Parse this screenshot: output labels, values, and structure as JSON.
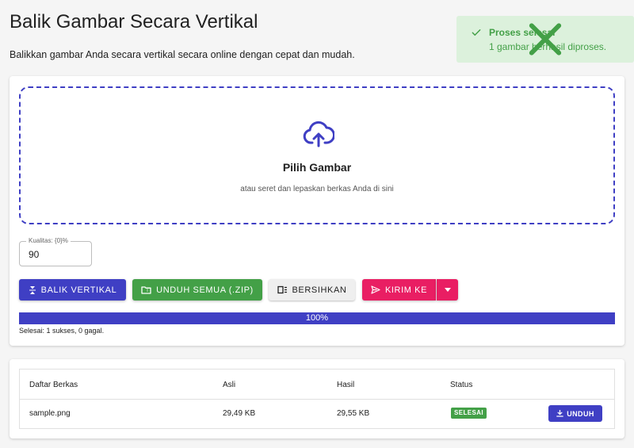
{
  "header": {
    "title": "Balik Gambar Secara Vertikal",
    "subtitle": "Balikkan gambar Anda secara vertikal secara online dengan cepat dan mudah."
  },
  "toast": {
    "title": "Proses selesai",
    "message": "1 gambar berhasil diproses."
  },
  "dropzone": {
    "title": "Pilih Gambar",
    "hint": "atau seret dan lepaskan berkas Anda di sini"
  },
  "quality": {
    "label": "Kualitas: {0}%",
    "value": "90"
  },
  "buttons": {
    "flip": "BALIK VERTIKAL",
    "download_all": "UNDUH SEMUA (.ZIP)",
    "clear": "BERSIHKAN",
    "send_to": "KIRIM KE"
  },
  "progress": {
    "value": 100,
    "label": "100%"
  },
  "result": "Selesai: 1 sukses, 0 gagal.",
  "files_table": {
    "headers": [
      "Daftar Berkas",
      "Asli",
      "Hasil",
      "Status"
    ],
    "rows": [
      {
        "name": "sample.png",
        "original": "29,49 KB",
        "result": "29,55 KB",
        "status": "SELESAI",
        "action": "UNDUH"
      }
    ]
  },
  "colors": {
    "primary": "#3f3fc4",
    "success": "#43a047",
    "accent": "#e91e63",
    "toast_bg": "#dcf1dc"
  },
  "icons": {
    "upload": "cloud-upload-icon",
    "flip": "flip-vertical-icon",
    "zip": "folder-zip-icon",
    "clear": "clear-list-icon",
    "send": "send-icon",
    "dropdown": "caret-down-icon",
    "download": "download-icon",
    "toast_check": "check-icon",
    "toast_close": "close-icon"
  }
}
